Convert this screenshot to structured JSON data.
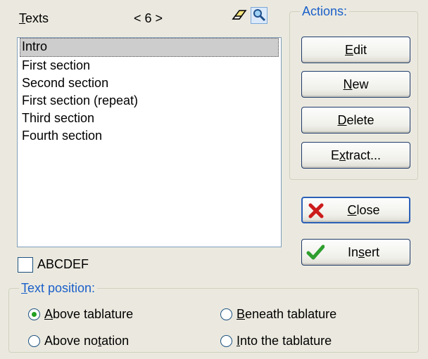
{
  "header": {
    "texts_label": "Texts",
    "count": "< 6 >",
    "eraser_icon": "eraser-icon",
    "search_icon": "magnifier-icon"
  },
  "list": {
    "items": [
      "Intro",
      "First section",
      "Second section",
      "First section (repeat)",
      "Third section",
      "Fourth section"
    ],
    "selected_index": 0
  },
  "checkbox": {
    "label": "ABCDEF",
    "checked": false
  },
  "actions": {
    "legend": "Actions:",
    "edit": "Edit",
    "new": "New",
    "delete": "Delete",
    "extract": "Extract...",
    "close": "Close",
    "insert": "Insert",
    "close_icon": "red-x-icon",
    "insert_icon": "green-check-icon"
  },
  "position": {
    "legend": "Text position:",
    "options": [
      {
        "label": "Above tablature",
        "checked": true
      },
      {
        "label": "Above notation",
        "checked": false
      },
      {
        "label": "Beneath tablature",
        "checked": false
      },
      {
        "label": "Into the tablature",
        "checked": false
      }
    ]
  },
  "colors": {
    "legend": "#1a5fc9",
    "selection": "#cdcdcd",
    "radio_dot": "#21a121",
    "close_x": "#cc1b1b",
    "check": "#2e9e2e"
  }
}
